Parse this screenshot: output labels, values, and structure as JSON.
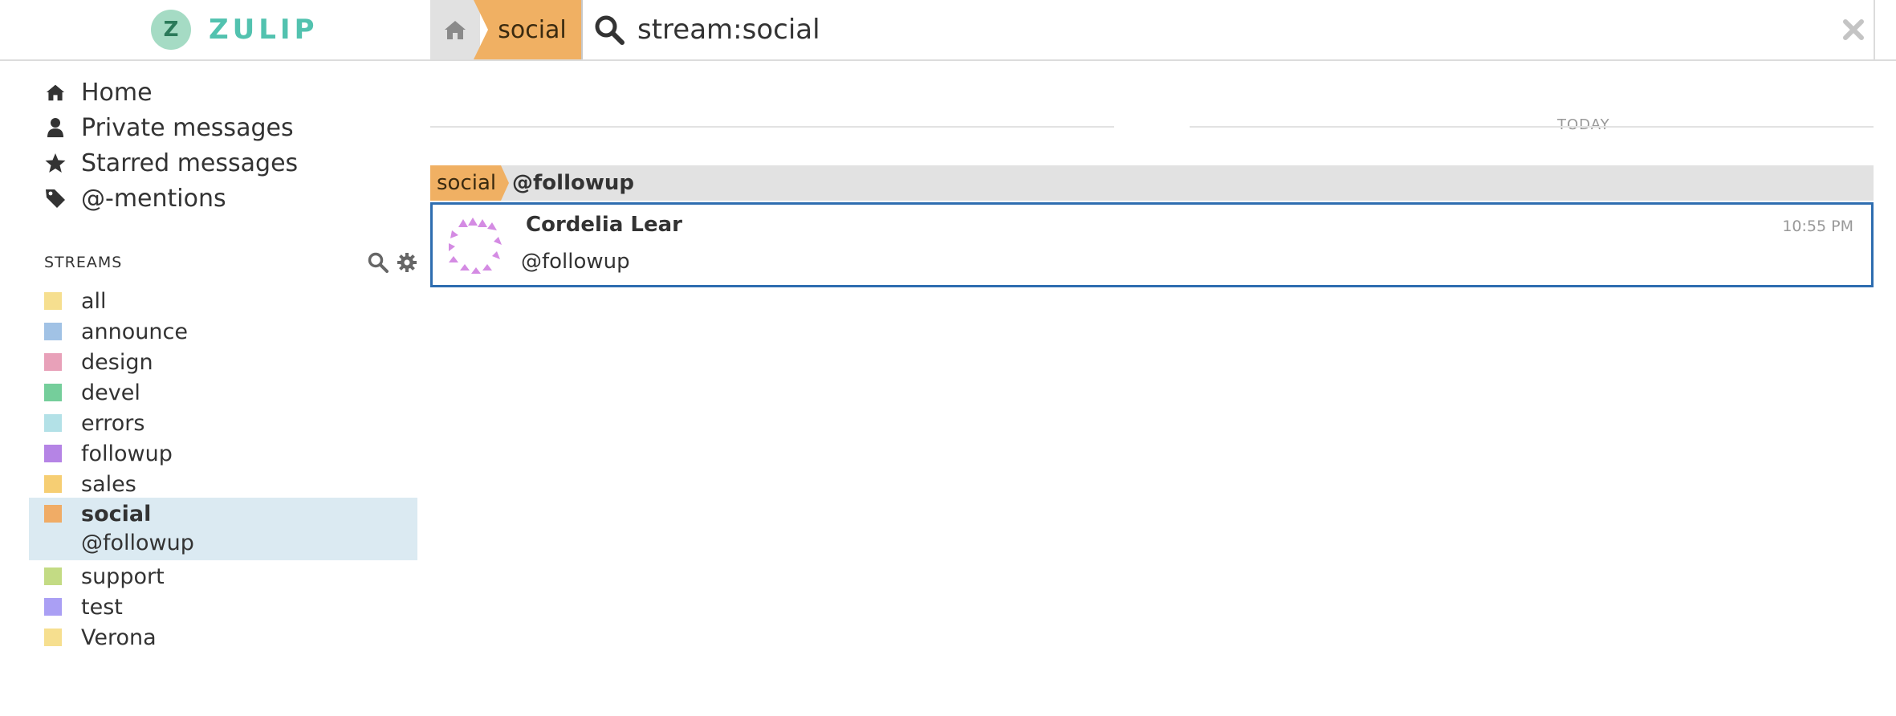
{
  "brand": {
    "logo_letter": "Z",
    "name": "ZULIP"
  },
  "narrow": {
    "stream": "social"
  },
  "search": {
    "query": "stream:social"
  },
  "sidebar": {
    "nav": [
      {
        "label": "Home",
        "icon": "home-icon"
      },
      {
        "label": "Private messages",
        "icon": "user-icon"
      },
      {
        "label": "Starred messages",
        "icon": "star-icon"
      },
      {
        "label": "@-mentions",
        "icon": "tag-icon"
      }
    ],
    "streams_header": "STREAMS",
    "streams": [
      {
        "name": "all",
        "color": "#f5d97b"
      },
      {
        "name": "announce",
        "color": "#90b7e1"
      },
      {
        "name": "design",
        "color": "#e490ad"
      },
      {
        "name": "devel",
        "color": "#5dc58a"
      },
      {
        "name": "errors",
        "color": "#a6dce3"
      },
      {
        "name": "followup",
        "color": "#a86ee0"
      },
      {
        "name": "sales",
        "color": "#f5c65a"
      },
      {
        "name": "support",
        "color": "#b8d56e"
      },
      {
        "name": "test",
        "color": "#9b8ef2"
      },
      {
        "name": "Verona",
        "color": "#f5d97b"
      }
    ],
    "active_stream": {
      "name": "social",
      "color": "#f3a14e",
      "topic": "@followup"
    }
  },
  "messages": {
    "date_label": "TODAY",
    "recipient": {
      "stream": "social",
      "topic": "@followup"
    },
    "items": [
      {
        "sender": "Cordelia Lear",
        "time": "10:55 PM",
        "content": "@followup"
      }
    ]
  }
}
